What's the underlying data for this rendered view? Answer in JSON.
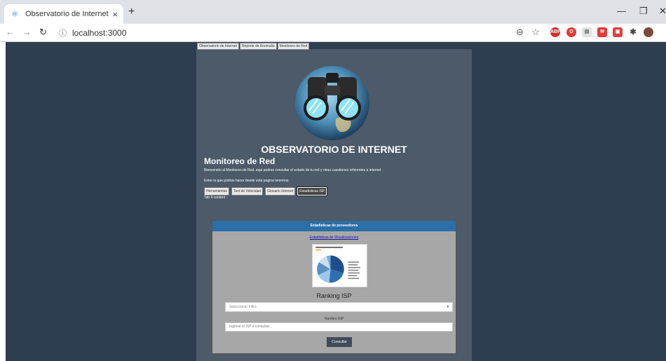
{
  "browser": {
    "tab_title": "Observatorio de Internet",
    "address": "localhost:3000",
    "new_tab": "+",
    "close": "×"
  },
  "page": {
    "nav_tabs": [
      "Observatorio de Internet",
      "Reporte de Anomalia",
      "Monitoreo de Red"
    ],
    "app_title": "OBSERVATORIO DE INTERNET",
    "section_title": "Monitoreo de Red",
    "intro": "Bienvenido al Monitoreo de Red, aqui podras consultar el estado de tu red y otras cuestiones referentes a internet",
    "intro2": "Entre lo que podras hacer desde esta pagina tenemos:",
    "tool_buttons": [
      "Herramientas",
      "Test de Velocidad",
      "Glosario Internet",
      "Estadisticas ISP"
    ],
    "tab_content": "Tab 4 content"
  },
  "stats": {
    "header": "Estadisticas de proveedores",
    "viz_link": "Estadisticas de Visualizaciones",
    "ranking_title": "Ranking ISP",
    "select_placeholder": "Seleccionar Filtro",
    "isp_label": "Nombre ISP",
    "isp_placeholder": "Ingrese el ISP a consultar...",
    "consult_label": "Consultar"
  },
  "colors": {
    "page_bg": "#2f3d50",
    "panel_bg": "#4c5a69",
    "card_header": "#2a6fa8",
    "card_bg": "#a7a7a7"
  }
}
